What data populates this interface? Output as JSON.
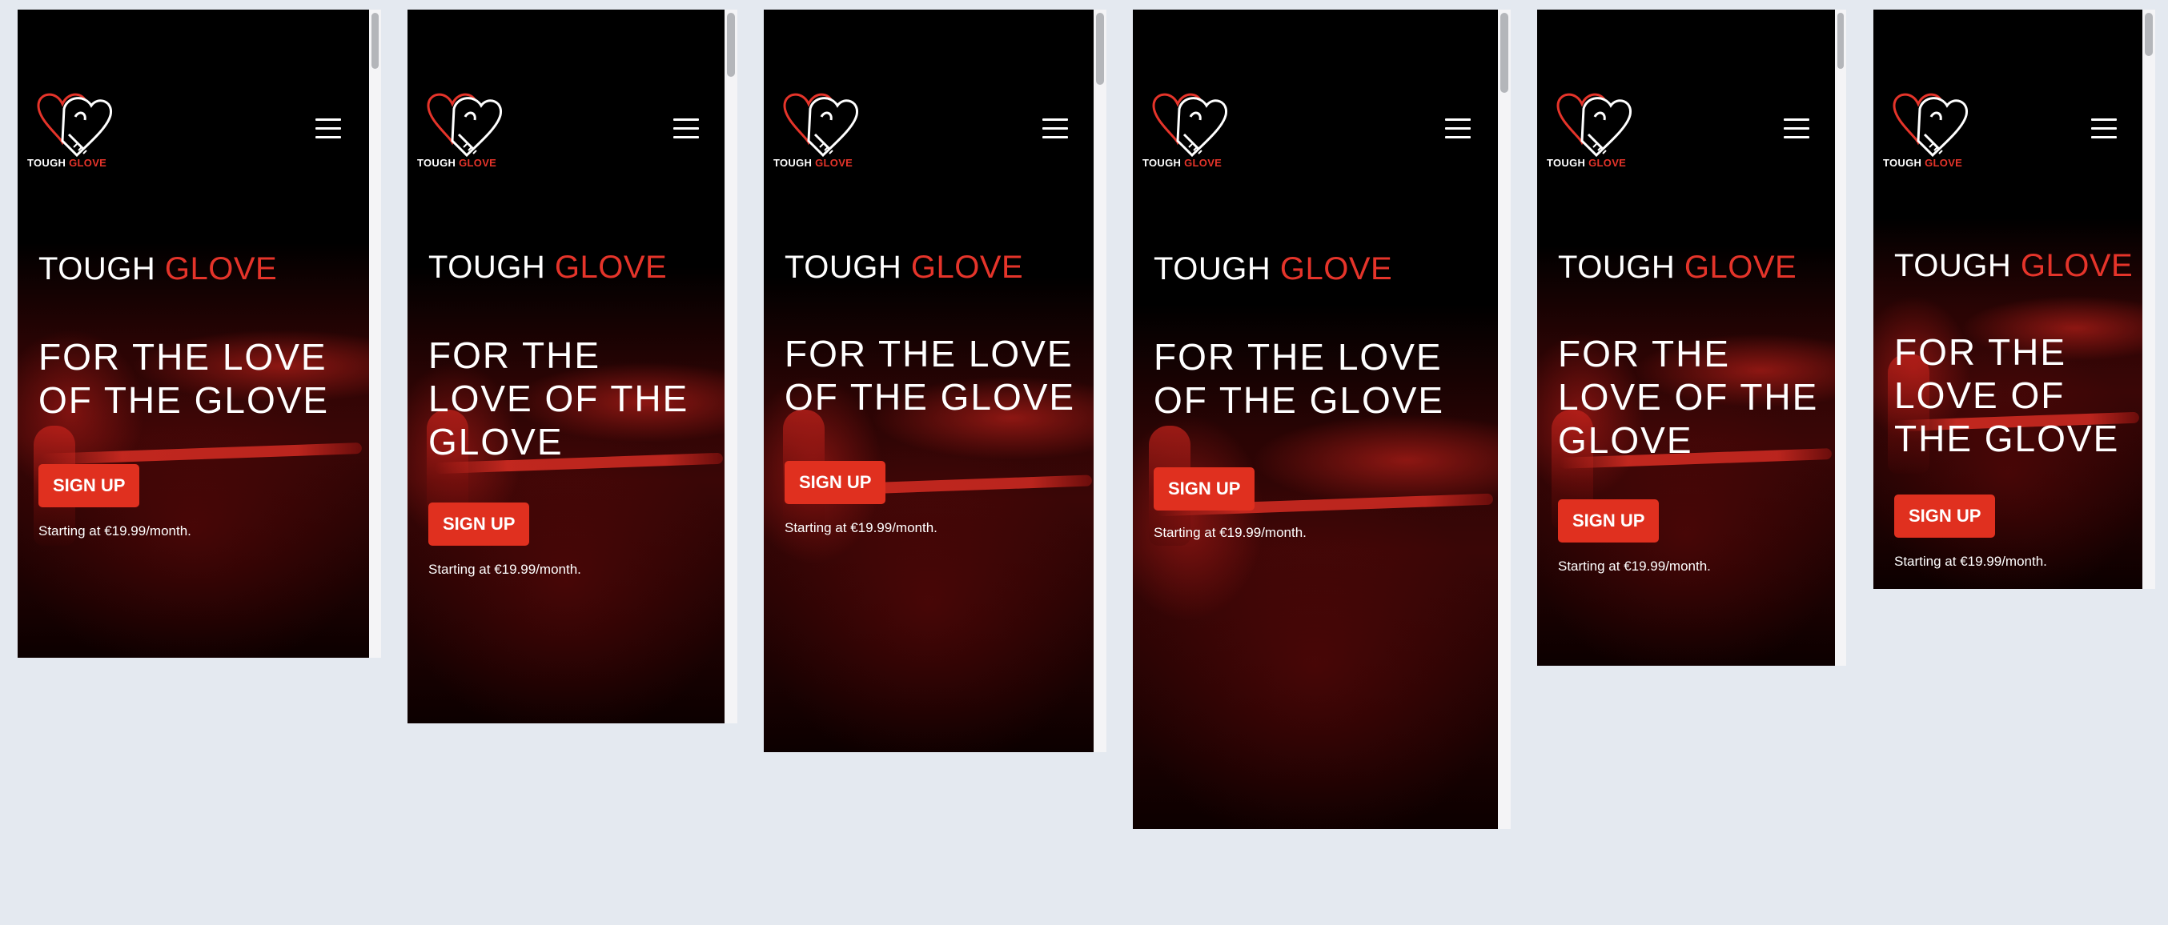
{
  "screens": [
    {
      "logo_white": "TOUGH",
      "logo_red": "GLOVE",
      "brand_white": "TOUGH",
      "brand_red": "GLOVE",
      "headline": [
        "FOR THE LOVE",
        "OF THE GLOVE"
      ],
      "cta": "SIGN UP",
      "price": "Starting at €19.99/month."
    },
    {
      "logo_white": "TOUGH",
      "logo_red": "GLOVE",
      "brand_white": "TOUGH",
      "brand_red": "GLOVE",
      "headline": [
        "FOR THE",
        "LOVE OF THE",
        "GLOVE"
      ],
      "cta": "SIGN UP",
      "price": "Starting at €19.99/month."
    },
    {
      "logo_white": "TOUGH",
      "logo_red": "GLOVE",
      "brand_white": "TOUGH",
      "brand_red": "GLOVE",
      "headline": [
        "FOR THE LOVE",
        "OF THE GLOVE"
      ],
      "cta": "SIGN UP",
      "price": "Starting at €19.99/month."
    },
    {
      "logo_white": "TOUGH",
      "logo_red": "GLOVE",
      "brand_white": "TOUGH",
      "brand_red": "GLOVE",
      "headline": [
        "FOR THE LOVE",
        "OF THE GLOVE"
      ],
      "cta": "SIGN UP",
      "price": "Starting at €19.99/month."
    },
    {
      "logo_white": "TOUGH",
      "logo_red": "GLOVE",
      "brand_white": "TOUGH",
      "brand_red": "GLOVE",
      "headline": [
        "FOR THE",
        "LOVE OF THE",
        "GLOVE"
      ],
      "cta": "SIGN UP",
      "price": "Starting at €19.99/month."
    },
    {
      "logo_white": "TOUGH",
      "logo_red": "GLOVE",
      "brand_white": "TOUGH",
      "brand_red": "GLOVE",
      "headline": [
        "FOR THE",
        "LOVE OF",
        "THE GLOVE"
      ],
      "cta": "SIGN UP",
      "price": "Starting at €19.99/month."
    }
  ],
  "icons": {
    "logo": "boxing-glove-heart-icon",
    "menu": "hamburger-menu-icon"
  },
  "colors": {
    "accent": "#e5342a",
    "button": "#e0301f",
    "background": "#000000",
    "canvas": "#e4e9f0"
  }
}
